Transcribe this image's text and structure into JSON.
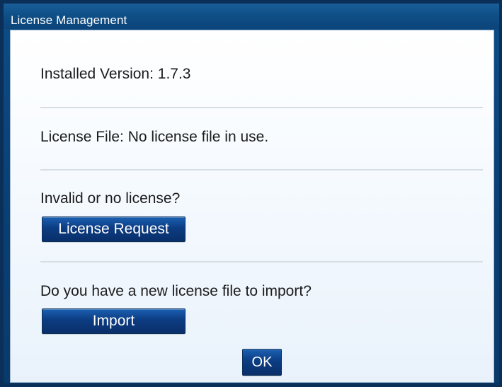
{
  "window": {
    "title": "License Management"
  },
  "content": {
    "installed_version_label": "Installed Version: 1.7.3",
    "license_file_label": "License File: No license file in use.",
    "invalid_license_prompt": "Invalid or no license?",
    "license_request_button": "License Request",
    "import_prompt": "Do you have a new license file to import?",
    "import_button": "Import",
    "ok_button": "OK"
  },
  "colors": {
    "window_frame": "#0a2f58",
    "titlebar_blue": "#0f4f87",
    "button_blue": "#0c3c82",
    "divider": "#d7dde4",
    "content_bg": "#f7fbff"
  }
}
